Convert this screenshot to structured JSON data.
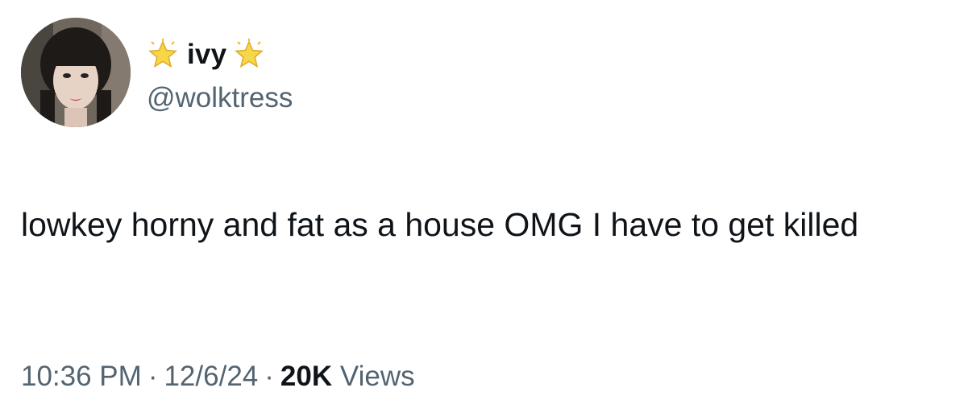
{
  "author": {
    "display_name": "ivy",
    "handle": "@wolktress",
    "avatar_icon": "profile-photo",
    "name_decoration_icon": "sparkle-star-emoji"
  },
  "tweet": {
    "text": "lowkey horny and fat as a house OMG I have to get killed"
  },
  "meta": {
    "time": "10:36 PM",
    "separator": "·",
    "date": "12/6/24",
    "views_count": "20K",
    "views_label": "Views"
  },
  "colors": {
    "text_primary": "#0f1419",
    "text_secondary": "#536471",
    "background": "#ffffff"
  }
}
